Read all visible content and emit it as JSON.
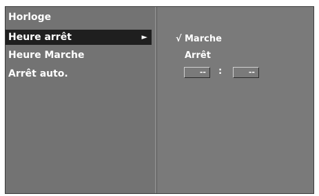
{
  "menu": {
    "items": [
      {
        "label": "Horloge"
      },
      {
        "label": "Heure arrêt",
        "arrow": "►"
      },
      {
        "label": "Heure Marche"
      },
      {
        "label": "Arrêt auto."
      }
    ],
    "selected_index": 1
  },
  "submenu": {
    "check_mark": "√",
    "options": [
      {
        "label": "Marche",
        "checked": true
      },
      {
        "label": "Arrêt",
        "checked": false
      }
    ],
    "time": {
      "hour": "--",
      "separator": ":",
      "minute": "--"
    }
  },
  "colors": {
    "left_panel": "#737373",
    "right_panel": "#7a7a7a",
    "highlight": "#1f1f1f",
    "text": "#ffffff"
  },
  "icons": {
    "selected_arrow": "right-triangle-icon",
    "check": "checkmark-icon"
  }
}
